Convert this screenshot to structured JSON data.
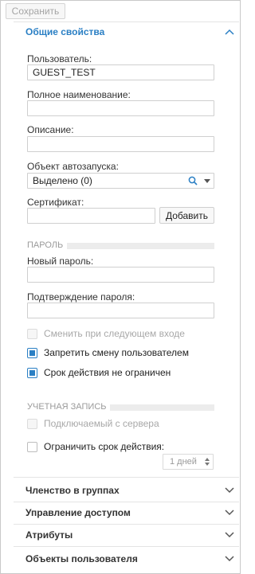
{
  "toolbar": {
    "save_label": "Сохранить"
  },
  "general": {
    "title": "Общие свойства",
    "user_label": "Пользователь:",
    "user_value": "GUEST_TEST",
    "fullname_label": "Полное наименование:",
    "fullname_value": "",
    "description_label": "Описание:",
    "description_value": "",
    "autostart_label": "Объект автозапуска:",
    "autostart_value": "Выделено (0)",
    "cert_label": "Сертификат:",
    "cert_value": "",
    "cert_add_label": "Добавить"
  },
  "password": {
    "group_title": "ПАРОЛЬ",
    "new_label": "Новый пароль:",
    "new_value": "",
    "confirm_label": "Подтверждение пароля:",
    "confirm_value": "",
    "checks": [
      {
        "label": "Сменить при следующем входе",
        "checked": false,
        "disabled": true
      },
      {
        "label": "Запретить смену пользователем",
        "checked": true,
        "disabled": false
      },
      {
        "label": "Срок действия не ограничен",
        "checked": true,
        "disabled": false
      }
    ]
  },
  "account": {
    "group_title": "УЧЕТНАЯ ЗАПИСЬ",
    "checks": [
      {
        "label": "Подключаемый с сервера",
        "checked": false,
        "disabled": true
      },
      {
        "label": "Ограничить срок действия:",
        "checked": false,
        "disabled": false
      }
    ],
    "days_value": "1 дней"
  },
  "sections": [
    {
      "title": "Членство в группах"
    },
    {
      "title": "Управление доступом"
    },
    {
      "title": "Атрибуты"
    },
    {
      "title": "Объекты пользователя"
    }
  ],
  "colors": {
    "accent": "#2a7fc4",
    "disabled_text": "#a8a8a8"
  }
}
